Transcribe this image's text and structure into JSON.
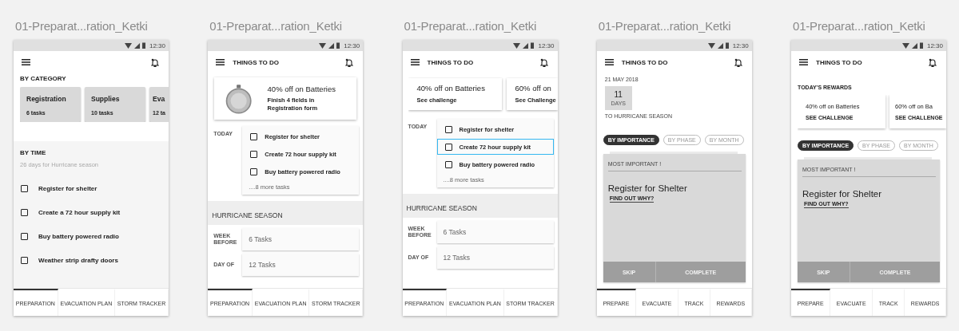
{
  "screens": [
    {
      "label": "01-Preparat...ration_Ketki",
      "time": "12:30",
      "categories": {
        "heading": "BY CATEGORY",
        "cards": [
          {
            "name": "Registration",
            "count": "6 tasks"
          },
          {
            "name": "Supplies",
            "count": "10 tasks"
          },
          {
            "name": "Eva",
            "count": "12 ta"
          }
        ]
      },
      "by_time": {
        "heading": "BY TIME",
        "subtitle": "26 days for Hurricane season",
        "tasks": [
          {
            "label": "Register for shelter",
            "checked": false
          },
          {
            "label": "Create a 72 hour supply kit",
            "checked": false
          },
          {
            "label": "Buy battery powered radio",
            "checked": false
          },
          {
            "label": "Weather strip drafty doors",
            "checked": false
          }
        ]
      },
      "tabs": [
        {
          "label": "PREPARATION",
          "selected": true
        },
        {
          "label": "EVACUATION PLAN",
          "selected": false
        },
        {
          "label": "STORM TRACKER",
          "selected": false
        }
      ]
    },
    {
      "label": "01-Preparat...ration_Ketki",
      "time": "12:30",
      "title": "THINGS TO DO",
      "promo": {
        "title": "40% off on Batteries",
        "text": "Finish 4 fields in Registration form"
      },
      "today": {
        "label": "TODAY",
        "tasks": [
          {
            "label": "Register for shelter",
            "checked": false,
            "selected": false
          },
          {
            "label": "Create 72 hour supply kit",
            "checked": false,
            "selected": false
          },
          {
            "label": "Buy battery powered radio",
            "checked": false,
            "selected": false
          }
        ],
        "more": "....8 more tasks"
      },
      "season": {
        "heading": "HURRICANE SEASON",
        "rows": [
          {
            "label": "WEEK BEFORE",
            "value": "6 Tasks"
          },
          {
            "label": "DAY OF",
            "value": "12 Tasks"
          }
        ]
      },
      "tabs": [
        {
          "label": "PREPARATION",
          "selected": true
        },
        {
          "label": "EVACUATION PLAN",
          "selected": false
        },
        {
          "label": "STORM TRACKER",
          "selected": false
        }
      ]
    },
    {
      "label": "01-Preparat...ration_Ketki",
      "time": "12:30",
      "title": "THINGS TO DO",
      "offers": [
        {
          "title": "40% off on Batteries",
          "link": "See challenge"
        },
        {
          "title": "60% off on",
          "link": "See Challenge"
        }
      ],
      "today": {
        "label": "TODAY",
        "tasks": [
          {
            "label": "Register for shelter",
            "checked": false,
            "selected": false
          },
          {
            "label": "Create 72 hour supply kit",
            "checked": false,
            "selected": true
          },
          {
            "label": "Buy battery powered radio",
            "checked": false,
            "selected": false
          }
        ],
        "more": "....8 more tasks"
      },
      "season": {
        "heading": "HURRICANE SEASON",
        "rows": [
          {
            "label": "WEEK BEFORE",
            "value": "6 Tasks"
          },
          {
            "label": "DAY OF",
            "value": "12 Tasks"
          }
        ]
      },
      "tabs": [
        {
          "label": "PREPARATION",
          "selected": true
        },
        {
          "label": "EVACUATION PLAN",
          "selected": false
        },
        {
          "label": "STORM TRACKER",
          "selected": false
        }
      ]
    },
    {
      "label": "01-Preparat...ration_Ketki",
      "time": "12:30",
      "title": "THINGS TO DO",
      "countdown": {
        "date": "21 MAY 2018",
        "number": "11",
        "unit": "DAYS",
        "caption": "TO HURRICANE SEASON"
      },
      "filters": [
        {
          "label": "BY IMPORTANCE",
          "selected": true
        },
        {
          "label": "BY PHASE",
          "selected": false
        },
        {
          "label": "BY MONTH",
          "selected": false
        }
      ],
      "task_card": {
        "eyebrow": "MOST IMPORTANT !",
        "title": "Register for Shelter",
        "link": "FIND OUT WHY?",
        "actions": [
          "SKIP",
          "COMPLETE"
        ]
      },
      "tabs": [
        {
          "label": "PREPARE",
          "selected": true
        },
        {
          "label": "EVACUATE",
          "selected": false
        },
        {
          "label": "TRACK",
          "selected": false
        },
        {
          "label": "REWARDS",
          "selected": false
        }
      ]
    },
    {
      "label": "01-Preparat...ration_Ketki",
      "time": "12:30",
      "title": "THINGS TO DO",
      "rewards": {
        "heading": "TODAY'S REWARDS",
        "offers": [
          {
            "title": "40% off on Batteries",
            "link": "SEE CHALLENGE"
          },
          {
            "title": "60% off on Ba",
            "link": "SEE CHALLENGE"
          }
        ]
      },
      "filters": [
        {
          "label": "BY IMPORTANCE",
          "selected": true
        },
        {
          "label": "BY PHASE",
          "selected": false
        },
        {
          "label": "BY MONTH",
          "selected": false
        }
      ],
      "task_card": {
        "eyebrow": "MOST IMPORTANT !",
        "title": "Register for Shelter",
        "link": "FIND OUT WHY?",
        "actions": [
          "SKIP",
          "COMPLETE"
        ]
      },
      "tabs": [
        {
          "label": "PREPARE",
          "selected": true
        },
        {
          "label": "EVACUATE",
          "selected": false
        },
        {
          "label": "TRACK",
          "selected": false
        },
        {
          "label": "REWARDS",
          "selected": false
        }
      ]
    }
  ]
}
